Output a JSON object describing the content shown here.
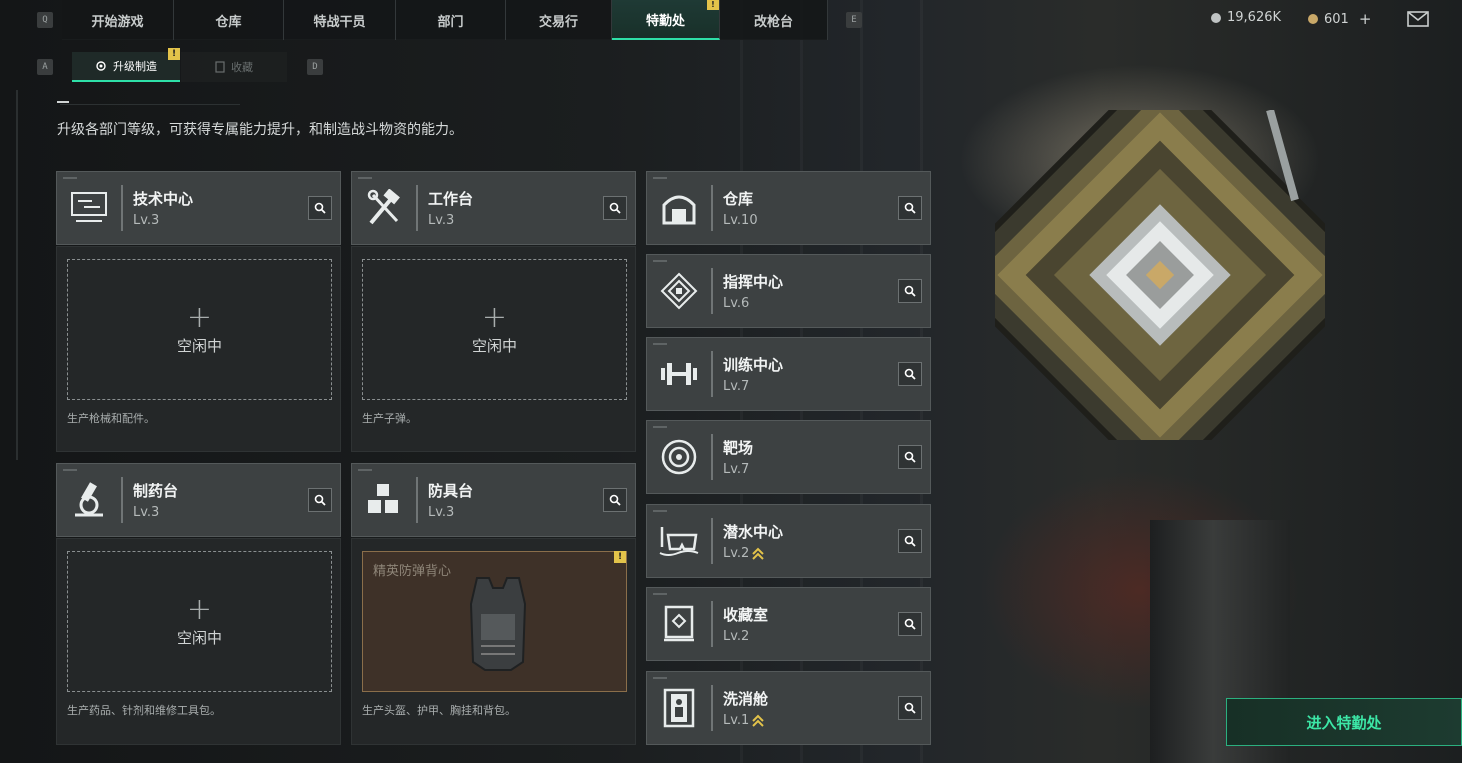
{
  "nav": {
    "left_key": "Q",
    "right_key": "E",
    "tabs": [
      {
        "label": "开始游戏"
      },
      {
        "label": "仓库"
      },
      {
        "label": "特战干员"
      },
      {
        "label": "部门"
      },
      {
        "label": "交易行"
      },
      {
        "label": "特勤处",
        "active": true,
        "alert": "!"
      },
      {
        "label": "改枪台"
      }
    ]
  },
  "subnav": {
    "left_key": "A",
    "right_key": "D",
    "tabs": [
      {
        "label": "升级制造",
        "active": true,
        "alert": "!"
      },
      {
        "label": "收藏"
      }
    ]
  },
  "currency": {
    "silver": "19,626K",
    "gold": "601",
    "add": "+"
  },
  "description": "升级各部门等级，可获得专属能力提升，和制造战斗物资的能力。",
  "production_facilities": [
    {
      "name": "技术中心",
      "level": "Lv.3",
      "icon": "monitor-icon",
      "slot_status": "空闲中",
      "slot_plus": "+",
      "desc": "生产枪械和配件。"
    },
    {
      "name": "工作台",
      "level": "Lv.3",
      "icon": "hammer-wrench-icon",
      "slot_status": "空闲中",
      "slot_plus": "+",
      "desc": "生产子弹。"
    },
    {
      "name": "制药台",
      "level": "Lv.3",
      "icon": "microscope-icon",
      "slot_status": "空闲中",
      "slot_plus": "+",
      "desc": "生产药品、针剂和维修工具包。"
    },
    {
      "name": "防具台",
      "level": "Lv.3",
      "icon": "armor-blocks-icon",
      "slot_item": "精英防弹背心",
      "item_alert": "!",
      "desc": "生产头盔、护甲、胸挂和背包。"
    }
  ],
  "other_facilities": [
    {
      "name": "仓库",
      "level": "Lv.10",
      "icon": "warehouse-icon"
    },
    {
      "name": "指挥中心",
      "level": "Lv.6",
      "icon": "command-icon"
    },
    {
      "name": "训练中心",
      "level": "Lv.7",
      "icon": "dumbbell-icon"
    },
    {
      "name": "靶场",
      "level": "Lv.7",
      "icon": "target-icon"
    },
    {
      "name": "潜水中心",
      "level": "Lv.2",
      "icon": "diving-mask-icon",
      "upgradable": true
    },
    {
      "name": "收藏室",
      "level": "Lv.2",
      "icon": "display-case-icon"
    },
    {
      "name": "洗消舱",
      "level": "Lv.1",
      "icon": "decon-chamber-icon",
      "upgradable": true
    }
  ],
  "enter_button": "进入特勤处",
  "colors": {
    "accent": "#2ee0a8",
    "alert": "#e3c34a",
    "card": "#3d4142"
  }
}
